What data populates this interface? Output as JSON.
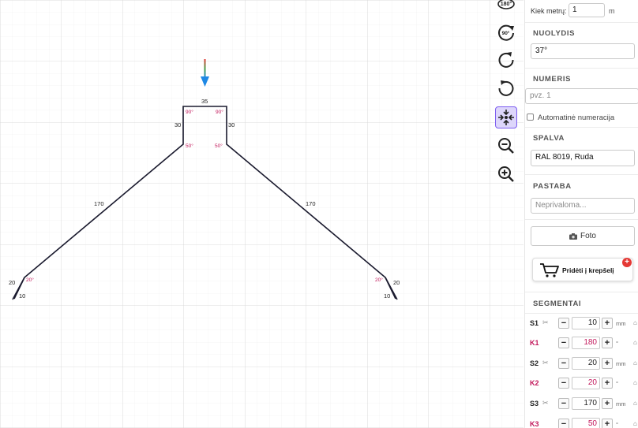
{
  "drawing": {
    "dimensions": {
      "top": "35",
      "left_vertical": "30",
      "right_vertical": "30",
      "left_slope": "170",
      "right_slope": "170",
      "left_hem_outer": "20",
      "left_hem_inner": "10",
      "right_hem_outer": "20",
      "right_hem_inner": "10"
    },
    "angles": {
      "top_left": "90°",
      "top_right": "90°",
      "mid_left": "50°",
      "mid_right": "50°",
      "hem_left": "20°",
      "hem_right": "20°"
    },
    "colors": {
      "profile": "#1a1a2e",
      "angle": "#c2185b",
      "grid": "#e3e3e3"
    }
  },
  "toolbar": {
    "tools": [
      {
        "icon": "rotate-180-icon",
        "label": "180°"
      },
      {
        "icon": "rotate-90-icon",
        "label": "90°"
      },
      {
        "icon": "rotate-clockwise-icon"
      },
      {
        "icon": "rotate-counterclockwise-icon"
      },
      {
        "icon": "center-icon",
        "active": true
      },
      {
        "icon": "zoom-out-icon"
      },
      {
        "icon": "zoom-in-icon"
      }
    ]
  },
  "panel": {
    "meters_label": "Kiek metrų:",
    "meters_value": "1",
    "meters_unit": "m",
    "slope_title": "NUOLYDIS",
    "slope_value": "37°",
    "number_title": "NUMERIS",
    "number_placeholder": "pvz. 1",
    "auto_numbering_label": "Automatinė numeracija",
    "color_title": "SPALVA",
    "color_value": "RAL 8019, Ruda",
    "note_title": "PASTABA",
    "note_placeholder": "Neprivaloma...",
    "photo_label": "Foto",
    "cart_label": "Pridėti į krepšelį",
    "segments_title": "SEGMENTAI",
    "segments": [
      {
        "name": "S1",
        "type": "s",
        "value": "10",
        "unit": "mm"
      },
      {
        "name": "K1",
        "type": "k",
        "value": "180",
        "unit": "°"
      },
      {
        "name": "S2",
        "type": "s",
        "value": "20",
        "unit": "mm"
      },
      {
        "name": "K2",
        "type": "k",
        "value": "20",
        "unit": "°"
      },
      {
        "name": "S3",
        "type": "s",
        "value": "170",
        "unit": "mm"
      },
      {
        "name": "K3",
        "type": "k",
        "value": "50",
        "unit": "°"
      }
    ],
    "accent_color": "#e53935"
  }
}
